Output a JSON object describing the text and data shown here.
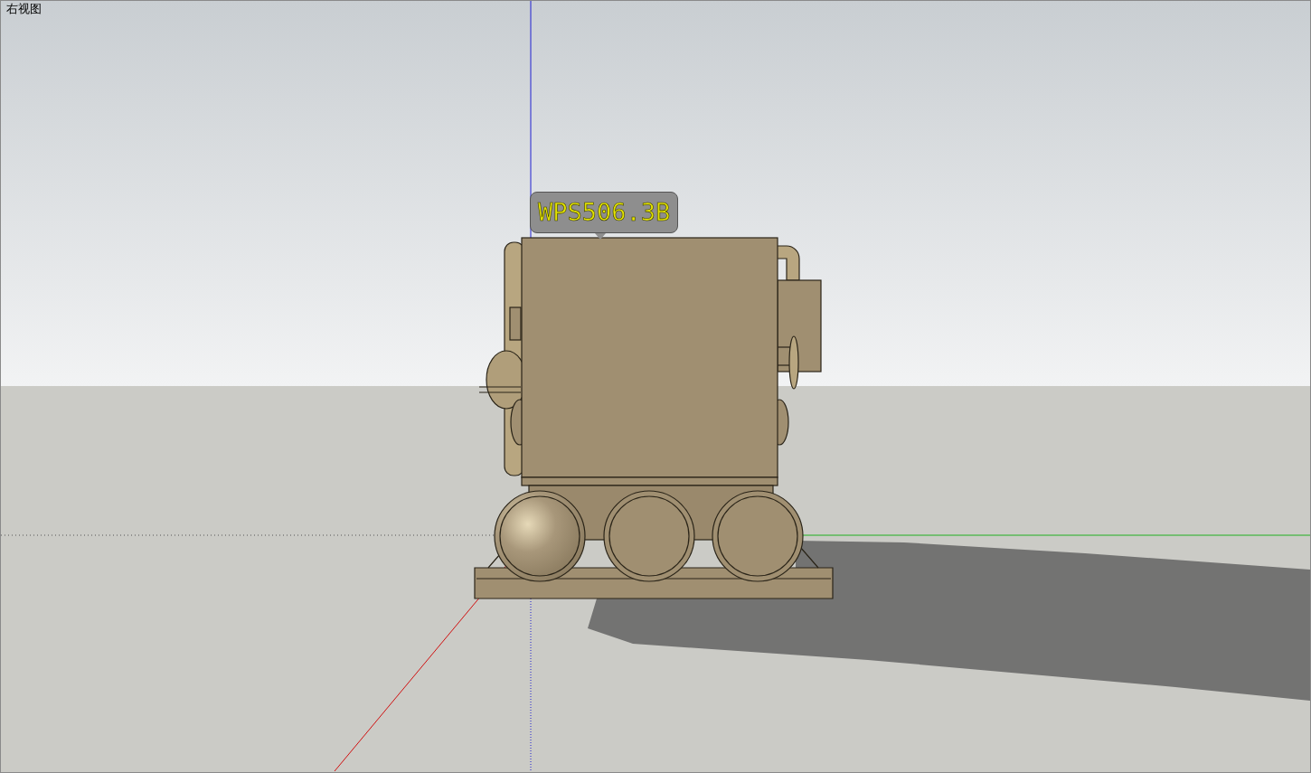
{
  "viewport": {
    "view_name": "右视图",
    "model_label": "WPS506.3B"
  }
}
